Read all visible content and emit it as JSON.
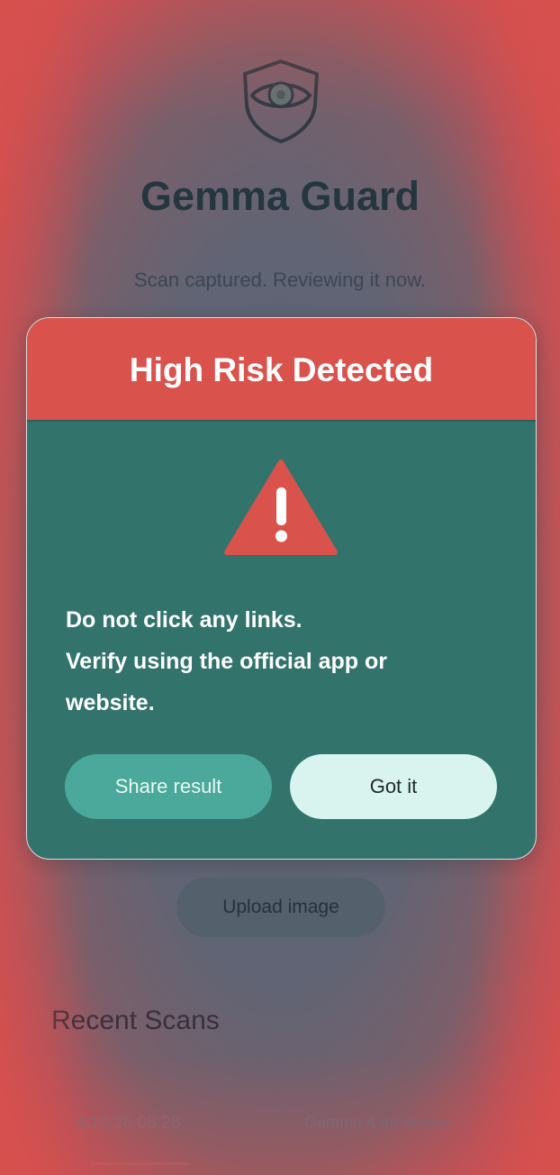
{
  "app": {
    "title": "Gemma Guard",
    "subtitle": "Scan captured. Reviewing it now."
  },
  "icons": {
    "logo": "shield-eye-icon",
    "warning": "warning-triangle-icon"
  },
  "colors": {
    "danger": "#d9534c",
    "dialog_body": "#32736c",
    "secondary_button": "#4aa99a",
    "primary_button": "#d9f4ee"
  },
  "dialog": {
    "title": "High Risk Detected",
    "message_lines": [
      "Do not click any links.",
      "Verify using the official app or",
      "website."
    ],
    "share_label": "Share result",
    "gotit_label": "Got it"
  },
  "upload": {
    "label": "Upload image"
  },
  "recent": {
    "title": "Recent Scans",
    "items": [
      {
        "time": "4/10/26 08:28",
        "source": "Gemma 4 on-device"
      }
    ]
  }
}
